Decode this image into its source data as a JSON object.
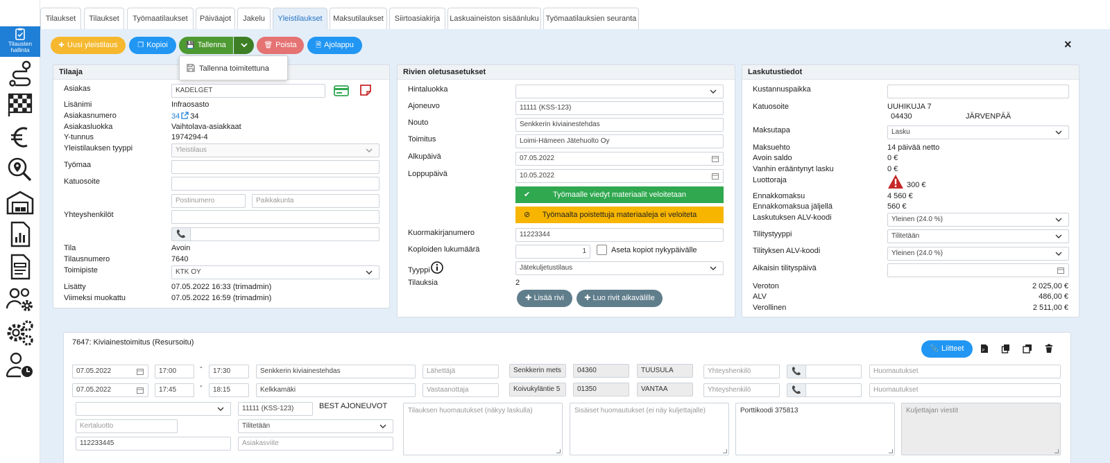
{
  "sidebar": {
    "active_label_1": "Tilausten",
    "active_label_2": "hallinta",
    "icons": [
      "route-icon",
      "racing-flag-icon",
      "euro-icon",
      "search-map-icon",
      "warehouse-icon",
      "report-icon",
      "document-icon",
      "users-settings-icon",
      "gears-icon",
      "user-clock-icon"
    ]
  },
  "tabs": [
    "Tilaukset",
    "Tilaukset",
    "Työmaatilaukset",
    "Päiväajot",
    "Jakelu",
    "Yleistilaukset",
    "Maksutilaukset",
    "Siirtoasiakirja",
    "Laskuaineiston sisäänluku",
    "Työmaatilauksien seuranta"
  ],
  "active_tab": 5,
  "toolbar": {
    "new": "Uusi yleistilaus",
    "copy": "Kopioi",
    "save": "Tallenna",
    "delete": "Poista",
    "report": "Ajolappu",
    "save_menu_item": "Tallenna toimitettuna",
    "close": "×"
  },
  "colors": {
    "yellow": "#f5b82e",
    "blue": "#2196f3",
    "green": "#4e9a32",
    "red": "#e57373",
    "tab_active": "#2a74c3",
    "bar_green": "#2fa84f",
    "bar_yellow": "#f7b500"
  },
  "tilaaja": {
    "title": "Tilaaja",
    "asiakas_label": "Asiakas",
    "asiakas_value": "KADELGET",
    "lisanimi_label": "Lisänimi",
    "lisanimi_value": "Infraosasto",
    "asiakasnumero_label": "Asiakasnumero",
    "asiakasnumero_link": "34",
    "asiakasnumero_value": "34",
    "asiakasluokka_label": "Asiakasluokka",
    "asiakasluokka_value": "Vaihtolava-asiakkaat",
    "ytunnus_label": "Y-tunnus",
    "ytunnus_value": "1974294-4",
    "tyyppi_label": "Yleistilauksen tyyppi",
    "tyyppi_value": "Yleistilaus",
    "tyomaa_label": "Työmaa",
    "katuosoite_label": "Katuosoite",
    "postinumero_ph": "Postinumero",
    "paikkakunta_ph": "Paikkakunta",
    "yhteyshenkilot_label": "Yhteyshenkilöt",
    "tila_label": "Tila",
    "tila_value": "Avoin",
    "tilausnumero_label": "Tilausnumero",
    "tilausnumero_value": "7640",
    "toimipiste_label": "Toimipiste",
    "toimipiste_value": "KTK OY",
    "lisatty_label": "Lisätty",
    "lisatty_value": "07.05.2022 16:33 (trimadmin)",
    "muokattu_label": "Viimeksi muokattu",
    "muokattu_value": "07.05.2022 16:59 (trimadmin)"
  },
  "rivien": {
    "title": "Rivien oletusasetukset",
    "hintaluokka_label": "Hintaluokka",
    "ajoneuvo_label": "Ajoneuvo",
    "ajoneuvo_value": "11111 (KSS-123)",
    "nouto_label": "Nouto",
    "nouto_value": "Senkkerin kiviainestehdas",
    "toimitus_label": "Toimitus",
    "toimitus_value": "Loimi-Hämeen Jätehuolto Oy",
    "alkupaiva_label": "Alkupäivä",
    "alkupaiva_value": "07.05.2022",
    "loppupaiva_label": "Loppupäivä",
    "loppupaiva_value": "10.05.2022",
    "green_bar": "Työmaalle viedyt materiaalit veloitetaan",
    "yellow_bar": "Työmaalta poistettuja materiaaleja ei veloiteta",
    "kuormakirja_label": "Kuormakirjanumero",
    "kuormakirja_value": "11223344",
    "koplo_label": "Koploiden lukumäärä",
    "koplo_value": "1",
    "aseta_label": "Aseta kopiot nykypäivälle",
    "tyyppi_label": "Tyyppi",
    "tyyppi_value": "Jätekuljetustilaus",
    "tilauksia_label": "Tilauksia",
    "tilauksia_value": "2",
    "add_row": "Lisää rivi",
    "add_rows_interval": "Luo rivit aikavälille"
  },
  "lasku": {
    "title": "Laskutustiedot",
    "kustannus_label": "Kustannuspaikka",
    "katuosoite_label": "Katuosoite",
    "katuosoite_value": "UUHIKUJA 7",
    "postinumero_value": "04430",
    "paikkakunta_value": "JÄRVENPÄÄ",
    "maksutapa_label": "Maksutapa",
    "maksutapa_value": "Lasku",
    "maksuehto_label": "Maksuehto",
    "maksuehto_value": "14 päivää netto",
    "avoin_label": "Avoin saldo",
    "avoin_value": "0 €",
    "vanhin_label": "Vanhin erääntynyt lasku",
    "vanhin_value": "0 €",
    "luottoraja_label": "Luottoraja",
    "luottoraja_value": "300 €",
    "ennakko_label": "Ennakkomaksu",
    "ennakko_value": "4 560 €",
    "ennakkojaljella_label": "Ennakkomaksua jäljellä",
    "ennakkojaljella_value": "560 €",
    "laskalv_label": "Laskutuksen ALV-koodi",
    "laskalv_value": "Yleinen (24.0 %)",
    "tilitys_label": "Tilitystyyppi",
    "tilitys_value": "Tilitetään",
    "tilalv_label": "Tilityksen ALV-koodi",
    "tilalv_value": "Yleinen (24.0 %)",
    "aikaisin_label": "Aikaisin tilityspäivä",
    "veroton_label": "Veroton",
    "veroton_value": "2 025,00 €",
    "alv_label": "ALV",
    "alv_value": "486,00 €",
    "verollinen_label": "Verollinen",
    "verollinen_value": "2 511,00 €"
  },
  "row": {
    "title": "7647: Kiviainestoimitus (Resursoitu)",
    "attachments": "Liitteet",
    "line1": {
      "date": "07.05.2022",
      "from": "17:00",
      "dash": "-",
      "to": "17:30",
      "place": "Senkkerin kiviainestehdas",
      "party_ph": "Lähettäjä",
      "street": "Senkkerin mets",
      "zip": "04360",
      "city": "TUUSULA",
      "contact_ph": "Yhteyshenkilö",
      "notes_ph": "Huomautukset"
    },
    "line2": {
      "date": "07.05.2022",
      "from": "17:45",
      "dash": "-",
      "to": "18:15",
      "place": "Kelkkamäki",
      "party_ph": "Vastaanottaja",
      "street": "Koivukyläntie 5",
      "zip": "01350",
      "city": "VANTAA",
      "contact_ph": "Yhteyshenkilö",
      "notes_ph": "Huomautukset"
    },
    "vehicle": "11111 (KSS-123)",
    "vehicle_company": "BEST AJONEUVOT",
    "kertaluotto_ph": "Kertaluotto",
    "tilitys_value": "Tilitetään",
    "ref_value": "112233445",
    "asiakasviite_ph": "Asiakasviite",
    "order_notes_ph": "Tilauksen huomautukset (näkyy laskulla)",
    "internal_notes_ph": "Sisäiset huomautukset (ei näy kuljettajalle)",
    "door_code": "Porttikoodi 375813",
    "driver_msgs_ph": "Kuljettajan viestit"
  }
}
